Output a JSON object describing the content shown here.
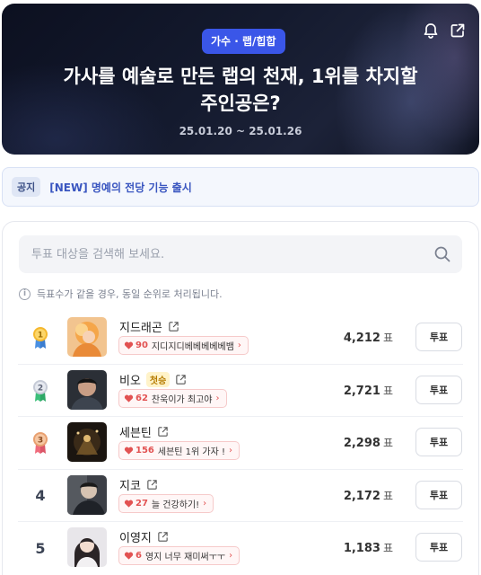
{
  "hero": {
    "category": "가수 · 랩/힙합",
    "title": "가사를 예술로 만든 랩의 천재, 1위를 차지할\n주인공은?",
    "period": "25.01.20 ~ 25.01.26",
    "icons": [
      "bell-icon",
      "share-icon"
    ]
  },
  "notice": {
    "tag": "공지",
    "text": "[NEW] 명예의 전당 기능 출시"
  },
  "search": {
    "placeholder": "투표 대상을 검색해 보세요."
  },
  "info": {
    "text": "득표수가 같을 경우, 동일 순위로 처리됩니다."
  },
  "rankings": [
    {
      "rank": "1",
      "name": "지드래곤",
      "badge": "",
      "cheer_count": "90",
      "cheer_msg": "지디지디베베베베베뱀",
      "votes": "4,212",
      "unit": "표",
      "button": "투표"
    },
    {
      "rank": "2",
      "name": "비오",
      "badge": "첫승",
      "cheer_count": "62",
      "cheer_msg": "찬욱이가 최고야",
      "votes": "2,721",
      "unit": "표",
      "button": "투표"
    },
    {
      "rank": "3",
      "name": "세븐틴",
      "badge": "",
      "cheer_count": "156",
      "cheer_msg": "세븐틴 1위 가자 !",
      "votes": "2,298",
      "unit": "표",
      "button": "투표"
    },
    {
      "rank": "4",
      "name": "지코",
      "badge": "",
      "cheer_count": "27",
      "cheer_msg": "늘 건강하기!",
      "votes": "2,172",
      "unit": "표",
      "button": "투표"
    },
    {
      "rank": "5",
      "name": "이영지",
      "badge": "",
      "cheer_count": "6",
      "cheer_msg": "영지 너무 재미써ㅜㅜ",
      "votes": "1,183",
      "unit": "표",
      "button": "투표"
    }
  ],
  "colors": {
    "accent": "#3a56e8",
    "gold": "#f5b82e",
    "silver": "#c5cad6",
    "bronze": "#e8a070",
    "heart": "#e25252"
  }
}
